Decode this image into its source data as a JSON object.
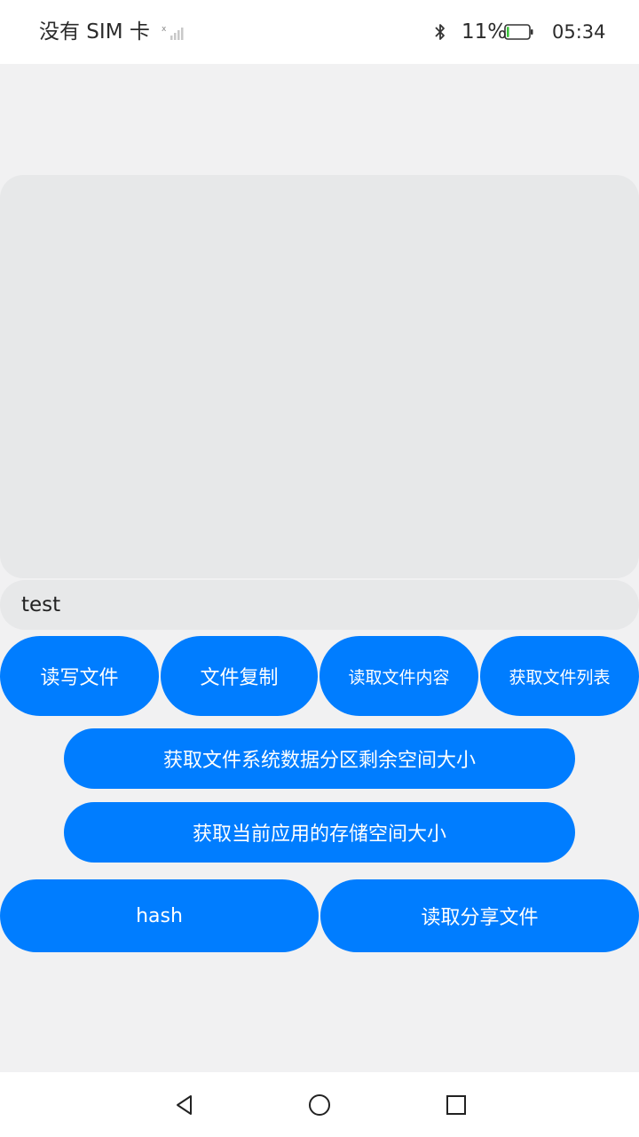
{
  "status_bar": {
    "carrier": "没有 SIM 卡",
    "battery_percent": "11%",
    "battery_level": 0.11,
    "time": "05:34",
    "icons": [
      "signal-icon",
      "bluetooth-icon",
      "battery-icon"
    ]
  },
  "input": {
    "value": "test"
  },
  "buttons": {
    "read_write_file": "读写文件",
    "copy_file": "文件复制",
    "read_file_content": "读取文件内容",
    "get_file_list": "获取文件列表",
    "get_free_space": "获取文件系统数据分区剩余空间大小",
    "get_app_storage": "获取当前应用的存储空间大小",
    "hash": "hash",
    "read_shared_file": "读取分享文件"
  },
  "nav": {
    "icons": [
      "back-icon",
      "home-icon",
      "recent-apps-icon"
    ]
  },
  "colors": {
    "accent": "#007dff",
    "background": "#f1f1f2",
    "panel": "#e7e8e9",
    "battery_level": "#3cc23c"
  }
}
